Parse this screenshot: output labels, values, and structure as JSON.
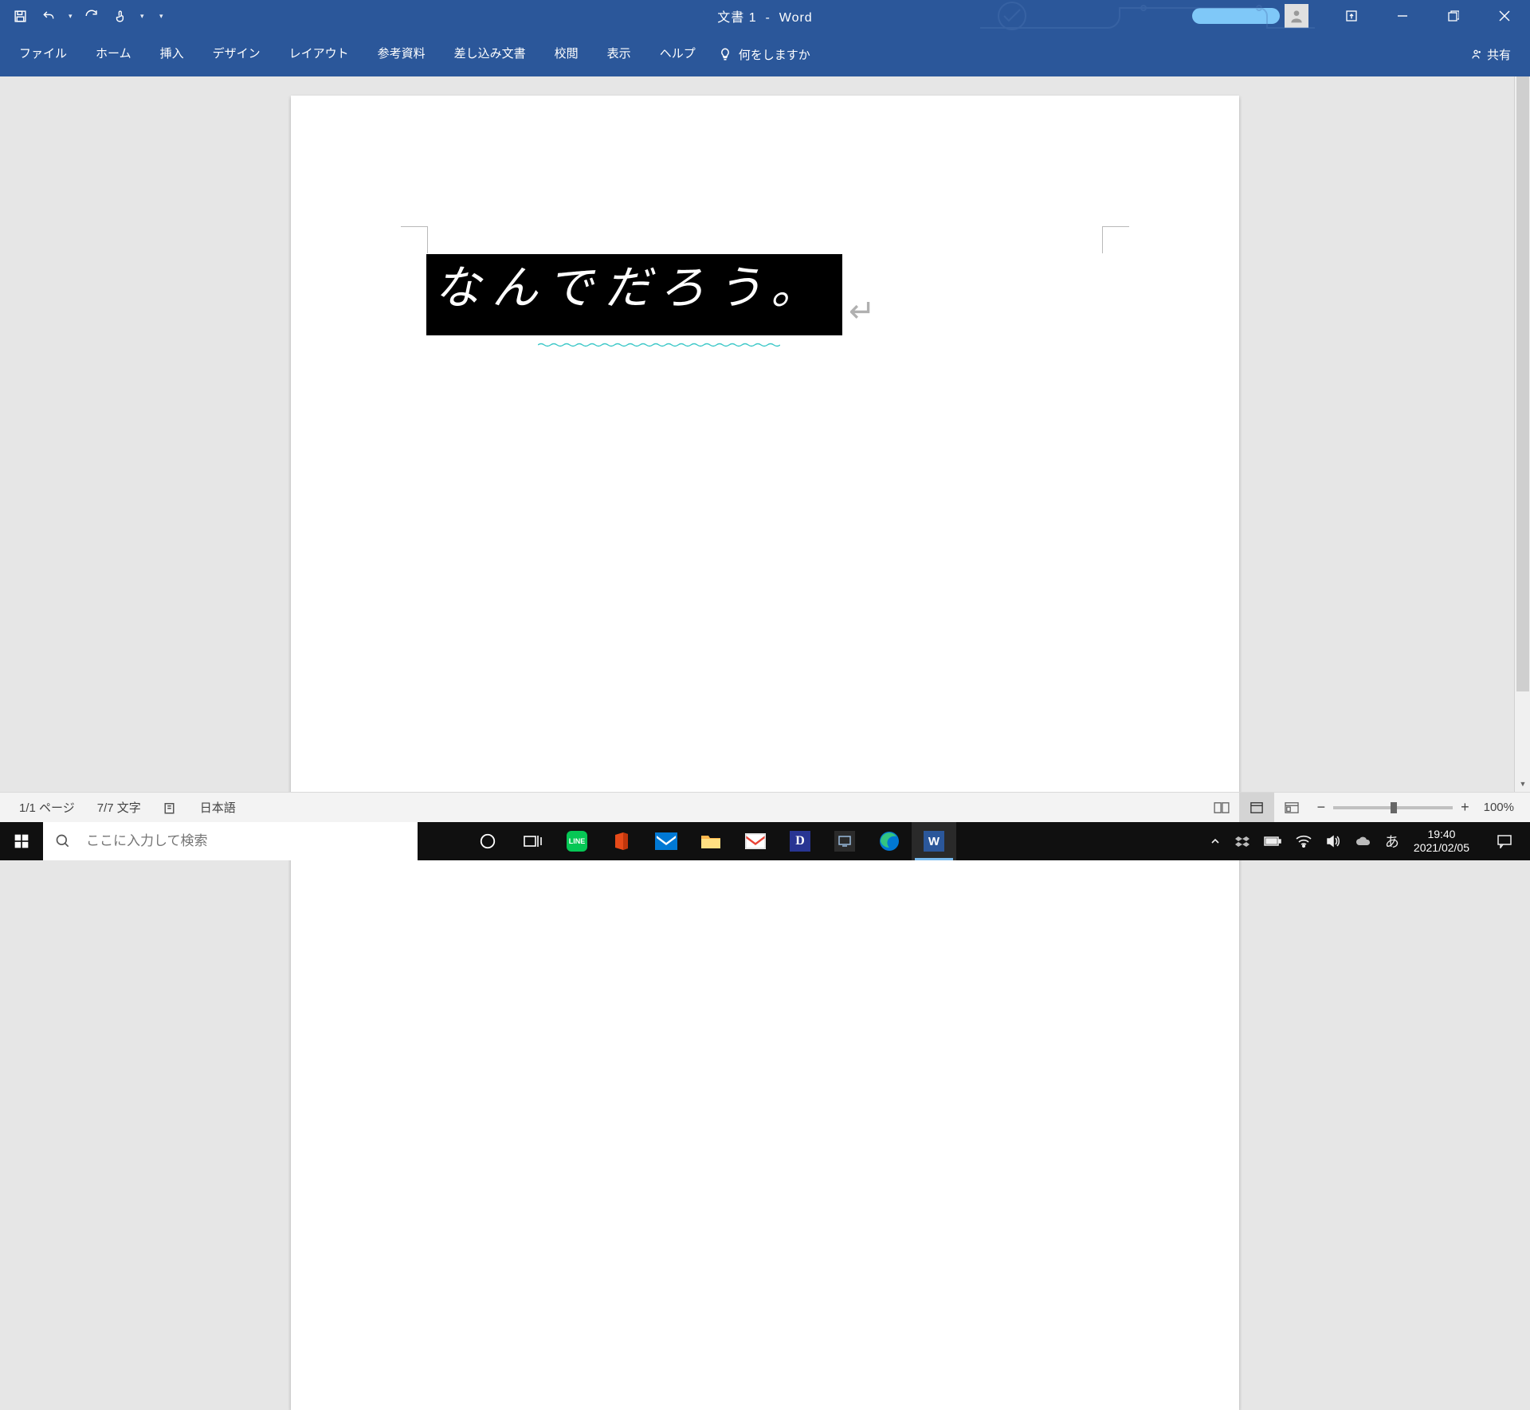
{
  "title": {
    "doc": "文書 1",
    "sep": "-",
    "app": "Word"
  },
  "ribbon": {
    "tabs": [
      "ファイル",
      "ホーム",
      "挿入",
      "デザイン",
      "レイアウト",
      "参考資料",
      "差し込み文書",
      "校閲",
      "表示",
      "ヘルプ"
    ],
    "tellme": "何をしますか",
    "share": "共有"
  },
  "document": {
    "selected_text": "なんでだろう。"
  },
  "status": {
    "page": "1/1 ページ",
    "chars": "7/7 文字",
    "lang": "日本語",
    "zoom": "100%"
  },
  "taskbar": {
    "search_placeholder": "ここに入力して検索",
    "ime": "あ",
    "time": "19:40",
    "date": "2021/02/05"
  }
}
